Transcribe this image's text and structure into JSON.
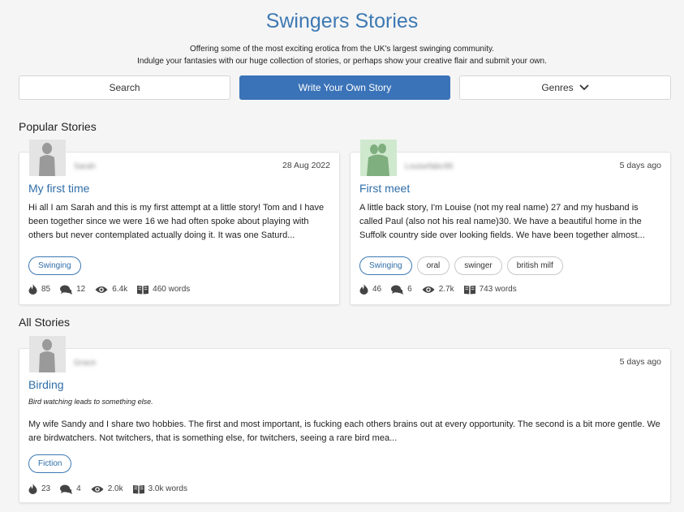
{
  "header": {
    "title": "Swingers Stories",
    "intro_line1": "Offering some of the most exciting erotica from the UK's largest swinging community.",
    "intro_line2": "Indulge your fantasies with our huge collection of stories, or perhaps show your creative flair and submit your own."
  },
  "toolbar": {
    "search_label": "Search",
    "write_label": "Write Your Own Story",
    "genres_label": "Genres",
    "primary_color": "#3a73b8"
  },
  "popular": {
    "heading": "Popular Stories",
    "stories": [
      {
        "author": "Sarah",
        "date": "28 Aug 2022",
        "title": "My first time",
        "excerpt": "Hi all I am Sarah and this is my first attempt at a little story! Tom and I have been together since we were 16 we had often spoke about playing with others but never contemplated actually doing it. It was one Saturd...",
        "tags": [
          "Swinging"
        ],
        "hearts": "85",
        "comments": "12",
        "views": "6.4k",
        "words": "460 words"
      },
      {
        "author": "Louisefabc95",
        "date": "5 days ago",
        "title": "First meet",
        "excerpt": "A little back story, I'm Louise (not my real name) 27 and my husband is called Paul (also not his real name)30. We have a beautiful home in the Suffolk country side over looking fields. We have been together almost...",
        "tags": [
          "Swinging",
          "oral",
          "swinger",
          "british milf"
        ],
        "hearts": "46",
        "comments": "6",
        "views": "2.7k",
        "words": "743 words"
      }
    ]
  },
  "all": {
    "heading": "All Stories",
    "stories": [
      {
        "author": "Grace",
        "date": "5 days ago",
        "title": "Birding",
        "subtitle": "Bird watching leads to something else.",
        "excerpt": "My wife Sandy and I share two hobbies. The first and most important, is fucking each others brains out at every opportunity. The second is a bit more gentle. We are birdwatchers. Not twitchers, that is something else, for twitchers, seeing a rare bird mea...",
        "tags": [
          "Fiction"
        ],
        "hearts": "23",
        "comments": "4",
        "views": "2.0k",
        "words": "3.0k words"
      }
    ]
  },
  "icons": {
    "hearts": "fire-icon",
    "comments": "comments-icon",
    "views": "eye-icon",
    "words": "book-icon",
    "genres": "chevron-down-icon"
  }
}
